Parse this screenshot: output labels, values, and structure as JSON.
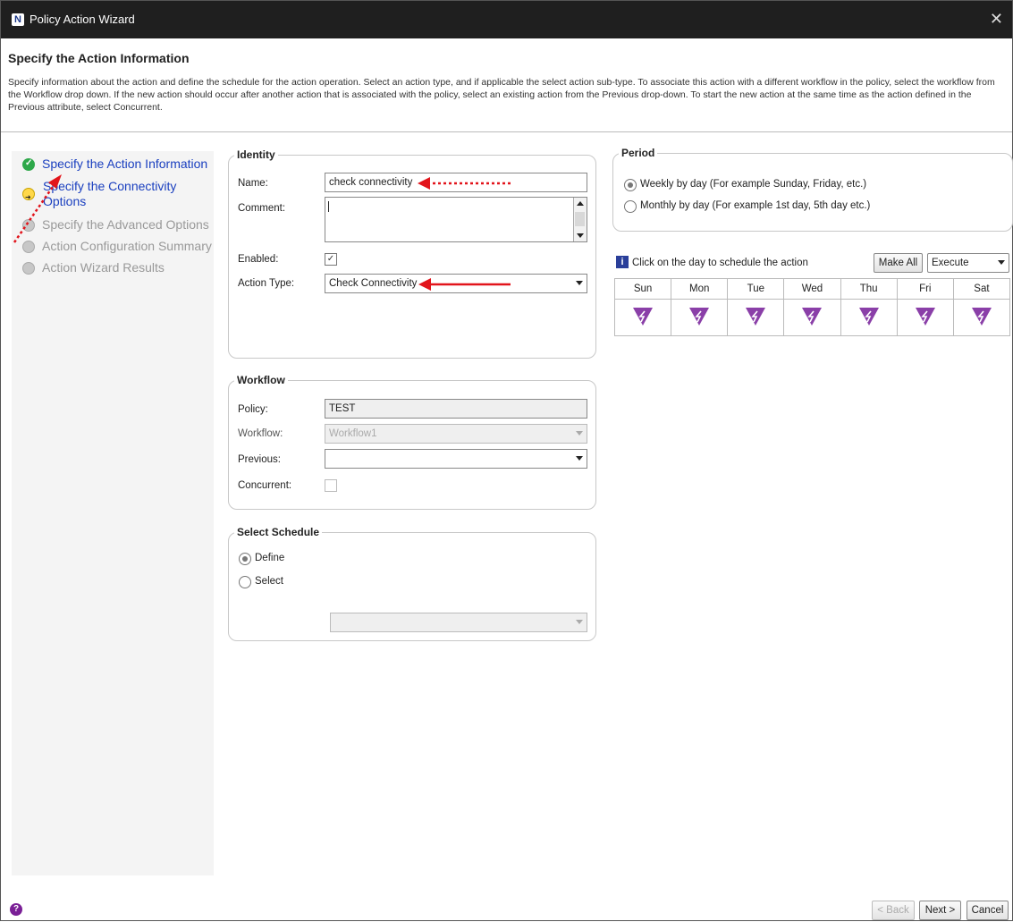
{
  "window": {
    "title": "Policy Action Wizard",
    "close_glyph": "✕"
  },
  "header": {
    "title": "Specify the Action Information",
    "description": "Specify information about the action and define the schedule for the action operation. Select an action type, and if applicable the select action sub-type. To associate this action with a different workflow in the policy, select the workflow from the Workflow drop down. If the new action should occur after another action that is associated with the policy, select an existing action from the Previous drop-down. To start the new action at the same time as the action defined in the Previous attribute, select Concurrent."
  },
  "steps": [
    {
      "label": "Specify the Action Information",
      "state": "complete",
      "icon": "check-circle-icon"
    },
    {
      "label": "Specify the Connectivity Options",
      "state": "current",
      "icon": "arrow-circle-icon"
    },
    {
      "label": "Specify the Advanced Options",
      "state": "disabled",
      "icon": "grey-circle-icon"
    },
    {
      "label": "Action Configuration Summary",
      "state": "disabled",
      "icon": "grey-circle-icon"
    },
    {
      "label": "Action Wizard Results",
      "state": "disabled",
      "icon": "grey-circle-icon"
    }
  ],
  "identity": {
    "title": "Identity",
    "name_label": "Name:",
    "name_value": "check connectivity",
    "comment_label": "Comment:",
    "comment_value": "",
    "enabled_label": "Enabled:",
    "enabled_checked": true,
    "action_type_label": "Action Type:",
    "action_type_value": "Check Connectivity"
  },
  "workflow": {
    "title": "Workflow",
    "policy_label": "Policy:",
    "policy_value": "TEST",
    "workflow_label": "Workflow:",
    "workflow_value": "Workflow1",
    "previous_label": "Previous:",
    "previous_value": "",
    "concurrent_label": "Concurrent:",
    "concurrent_checked": false
  },
  "schedule": {
    "title": "Select Schedule",
    "define_label": "Define",
    "select_label": "Select",
    "selected": "Define",
    "schedule_value": ""
  },
  "period": {
    "title": "Period",
    "weekly_label": "Weekly by day  (For example Sunday, Friday, etc.)",
    "monthly_label": "Monthly by day (For example 1st day, 5th day etc.)",
    "selected": "weekly"
  },
  "calendar": {
    "info_glyph": "i",
    "hint": "Click on the day to schedule the action",
    "make_all_label": "Make All",
    "execute_value": "Execute",
    "days": [
      "Sun",
      "Mon",
      "Tue",
      "Wed",
      "Thu",
      "Fri",
      "Sat"
    ]
  },
  "footer": {
    "help_glyph": "?",
    "back_label": "< Back",
    "next_label": "Next >",
    "cancel_label": "Cancel"
  },
  "colors": {
    "titlebar": "#1f1f1f",
    "current_step": "#1a3fbf",
    "annotation_red": "#e2141b",
    "day_icon": "#8a3fa8"
  }
}
